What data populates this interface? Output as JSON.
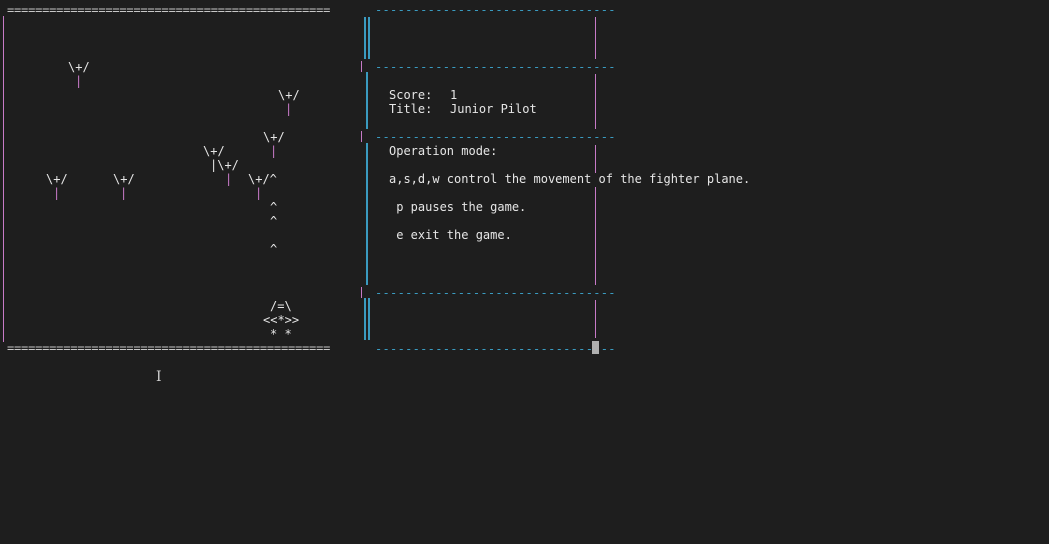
{
  "game": {
    "border_eq": "==============================================",
    "border_dash": "--------------------------------",
    "enemy_top": "\\+/",
    "enemy_bottom": "|",
    "enemy_cluster_mid": "|\\+/",
    "enemy_with_bullet": "\\+/^",
    "bullet": "^",
    "player": {
      "row1": "/=\\",
      "row2": "<<*>>",
      "row3": "* *"
    }
  },
  "panel": {
    "score_label": "Score:",
    "score_value": "1",
    "title_label": "Title:",
    "title_value": "Junior Pilot",
    "operation_heading": "Operation mode:",
    "instructions": [
      "a,s,d,w control the movement of the fighter plane.",
      " p pauses the game.",
      " e exit the game."
    ]
  }
}
